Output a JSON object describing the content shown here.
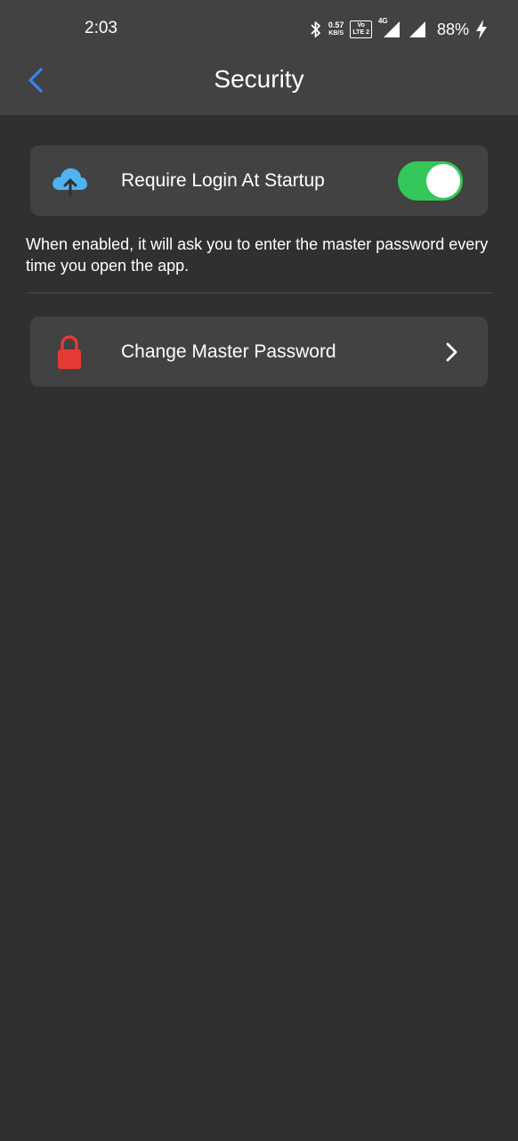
{
  "status_bar": {
    "time": "2:03",
    "net_speed_value": "0.57",
    "net_speed_unit": "KB/S",
    "volte_top": "Vo",
    "volte_bottom": "LTE 2",
    "network_type": "4G",
    "battery": "88%"
  },
  "header": {
    "title": "Security"
  },
  "settings": {
    "require_login": {
      "label": "Require Login At Startup",
      "enabled": true,
      "description": "When enabled, it will ask you to enter the master password every time you open the app."
    },
    "change_password": {
      "label": "Change Master Password"
    }
  },
  "colors": {
    "background": "#303030",
    "surface": "#424242",
    "accent_back": "#3b82f6",
    "toggle_on": "#34c759",
    "cloud_icon": "#4fb3f0",
    "lock_icon": "#e53935"
  },
  "icons": {
    "back": "chevron-left-icon",
    "require_login": "cloud-upload-icon",
    "change_password": "lock-icon",
    "change_password_action": "chevron-right-icon"
  }
}
